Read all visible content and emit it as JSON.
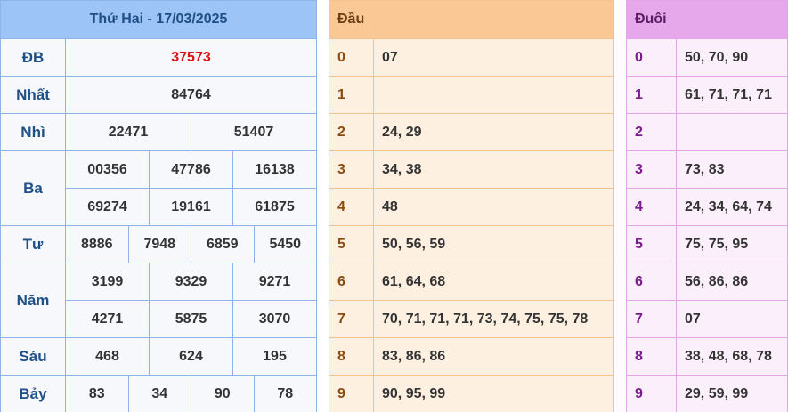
{
  "results": {
    "title": "Thứ Hai - 17/03/2025",
    "labels": {
      "db": "ĐB",
      "nhat": "Nhất",
      "nhi": "Nhì",
      "ba": "Ba",
      "tu": "Tư",
      "nam": "Năm",
      "sau": "Sáu",
      "bay": "Bảy"
    },
    "db": "37573",
    "nhat": "84764",
    "nhi": [
      "22471",
      "51407"
    ],
    "ba": [
      "00356",
      "47786",
      "16138",
      "69274",
      "19161",
      "61875"
    ],
    "tu": [
      "8886",
      "7948",
      "6859",
      "5450"
    ],
    "nam": [
      "3199",
      "9329",
      "9271",
      "4271",
      "5875",
      "3070"
    ],
    "sau": [
      "468",
      "624",
      "195"
    ],
    "bay": [
      "83",
      "34",
      "90",
      "78"
    ]
  },
  "dau": {
    "header": "Đầu",
    "rows": [
      {
        "index": "0",
        "values": "07"
      },
      {
        "index": "1",
        "values": ""
      },
      {
        "index": "2",
        "values": "24, 29"
      },
      {
        "index": "3",
        "values": "34, 38"
      },
      {
        "index": "4",
        "values": "48"
      },
      {
        "index": "5",
        "values": "50, 56, 59"
      },
      {
        "index": "6",
        "values": "61, 64, 68"
      },
      {
        "index": "7",
        "values": "70, 71, 71, 71, 73, 74, 75, 75, 78"
      },
      {
        "index": "8",
        "values": "83, 86, 86"
      },
      {
        "index": "9",
        "values": "90, 95, 99"
      }
    ]
  },
  "duoi": {
    "header": "Đuôi",
    "rows": [
      {
        "index": "0",
        "values": "50, 70, 90"
      },
      {
        "index": "1",
        "values": "61, 71, 71, 71"
      },
      {
        "index": "2",
        "values": ""
      },
      {
        "index": "3",
        "values": "73, 83"
      },
      {
        "index": "4",
        "values": "24, 34, 64, 74"
      },
      {
        "index": "5",
        "values": "75, 75, 95"
      },
      {
        "index": "6",
        "values": "56, 86, 86"
      },
      {
        "index": "7",
        "values": "07"
      },
      {
        "index": "8",
        "values": "38, 48, 68, 78"
      },
      {
        "index": "9",
        "values": "29, 59, 99"
      }
    ]
  }
}
